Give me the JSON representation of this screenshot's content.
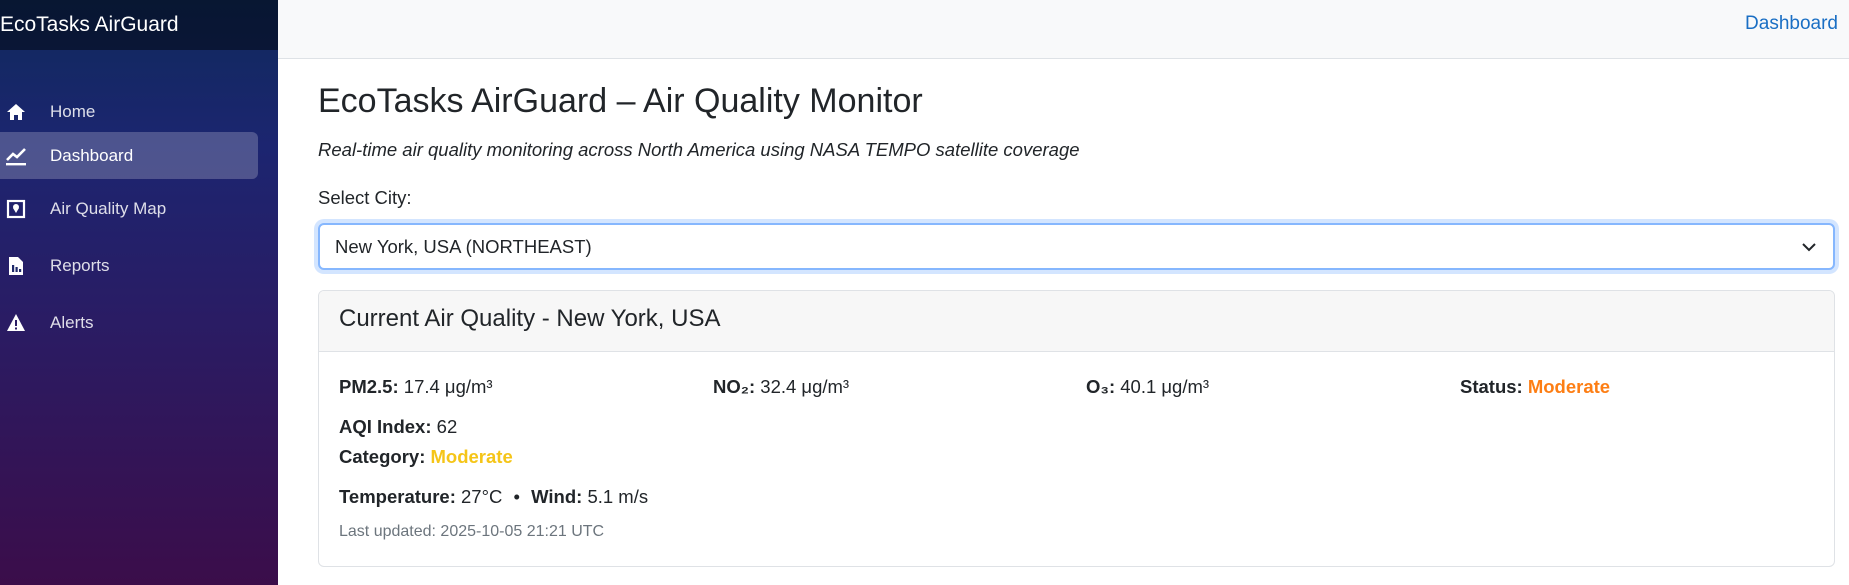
{
  "app": {
    "brand": "EcoTasks AirGuard"
  },
  "sidebar": {
    "items": [
      {
        "label": "Home",
        "icon": "home-icon",
        "active": false
      },
      {
        "label": "Dashboard",
        "icon": "chart-line-icon",
        "active": true
      },
      {
        "label": "Air Quality Map",
        "icon": "map-pin-icon",
        "active": false
      },
      {
        "label": "Reports",
        "icon": "report-icon",
        "active": false
      },
      {
        "label": "Alerts",
        "icon": "warning-icon",
        "active": false
      }
    ]
  },
  "topbar": {
    "link": "Dashboard"
  },
  "main": {
    "title": "EcoTasks AirGuard – Air Quality Monitor",
    "subtitle": "Real-time air quality monitoring across North America using NASA TEMPO satellite coverage",
    "select_label": "Select City:",
    "select_value": "New York, USA (NORTHEAST)"
  },
  "card": {
    "header": "Current Air Quality - New York, USA",
    "pm25": {
      "label": "PM2.5:",
      "value": "17.4 μg/m³"
    },
    "no2": {
      "label": "NO₂:",
      "value": "32.4 μg/m³"
    },
    "o3": {
      "label": "O₃:",
      "value": "40.1 μg/m³"
    },
    "status": {
      "label": "Status:",
      "value": "Moderate"
    },
    "aqi": {
      "label": "AQI Index:",
      "value": "62"
    },
    "category": {
      "label": "Category:",
      "value": "Moderate"
    },
    "temperature": {
      "label": "Temperature:",
      "value": "27°C"
    },
    "separator": "•",
    "wind": {
      "label": "Wind:",
      "value": "5.1 m/s"
    },
    "updated": "Last updated: 2025-10-05 21:21 UTC"
  },
  "colors": {
    "status_moderate": "#fd7e14",
    "category_moderate": "#f5c518",
    "link": "#1a6fc4",
    "focus_border": "#86b7fe"
  }
}
